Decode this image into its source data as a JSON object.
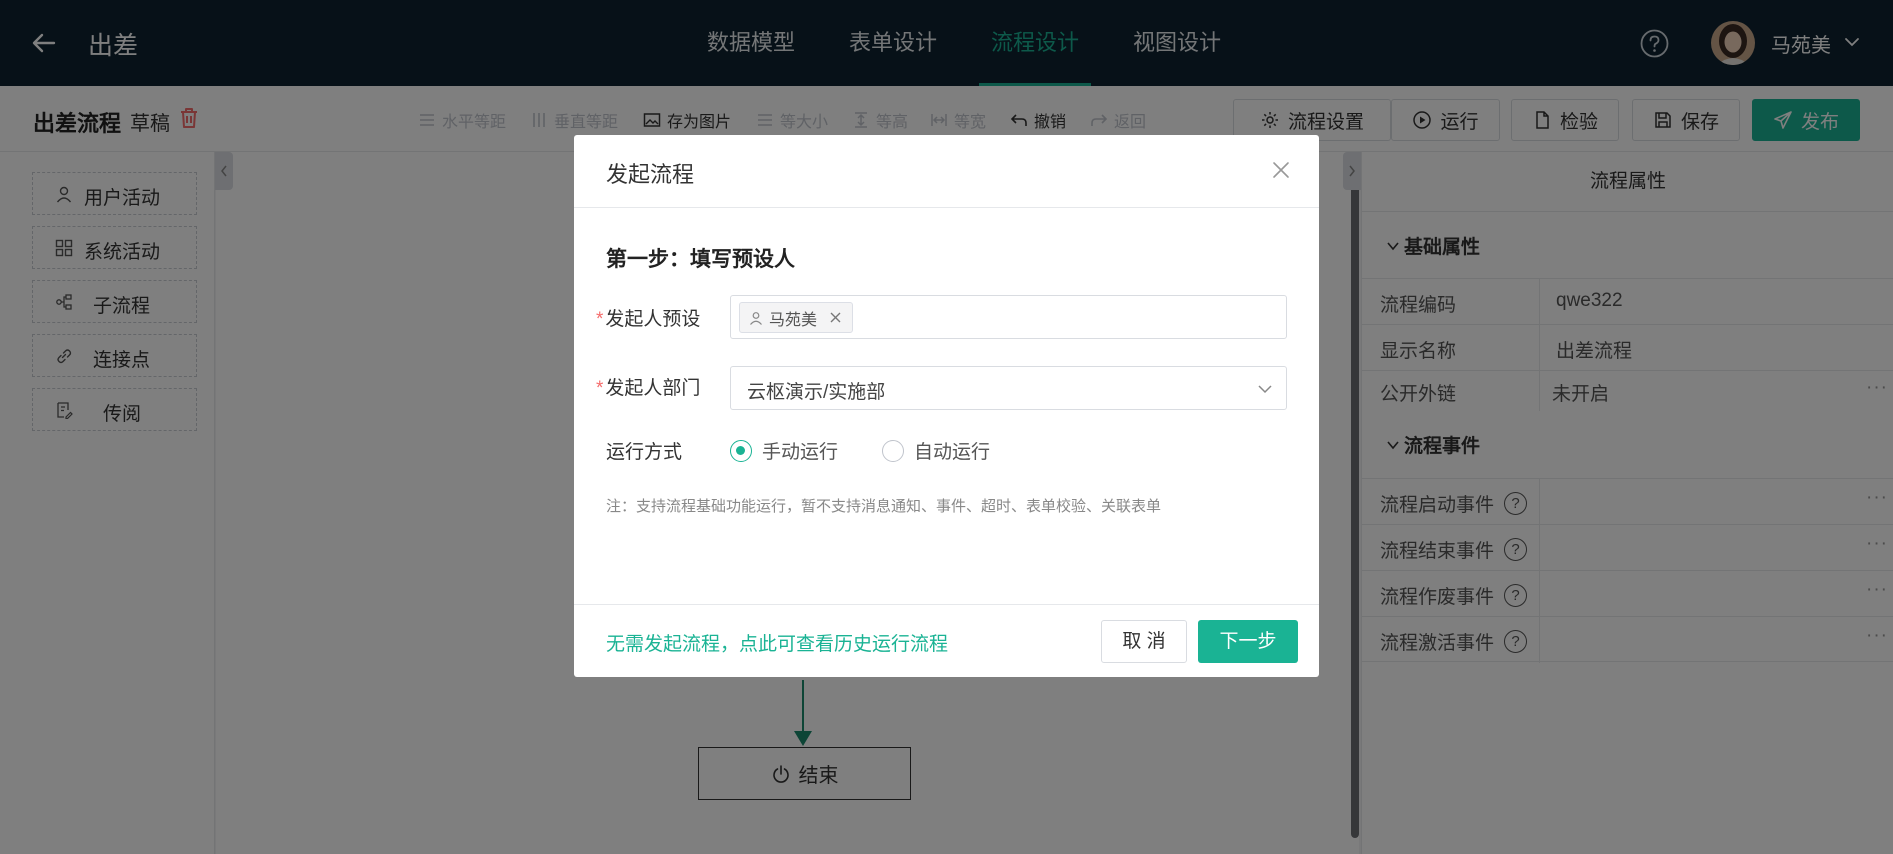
{
  "header": {
    "title": "出差",
    "tabs": [
      {
        "label": "数据模型",
        "active": false
      },
      {
        "label": "表单设计",
        "active": false
      },
      {
        "label": "流程设计",
        "active": true
      },
      {
        "label": "视图设计",
        "active": false
      }
    ],
    "user": {
      "name": "马苑美"
    }
  },
  "toolbar": {
    "flow_name": "出差流程",
    "status": "草稿",
    "tools": {
      "h_spacing": "水平等距",
      "v_spacing": "垂直等距",
      "save_image": "存为图片",
      "same_size": "等大小",
      "same_height": "等高",
      "same_width": "等宽",
      "undo": "撤销",
      "redo": "返回"
    },
    "buttons": {
      "settings": "流程设置",
      "run": "运行",
      "check": "检验",
      "save": "保存",
      "publish": "发布"
    }
  },
  "palette": {
    "items": [
      {
        "label": "用户活动",
        "icon": "user-icon"
      },
      {
        "label": "系统活动",
        "icon": "grid-icon"
      },
      {
        "label": "子流程",
        "icon": "subflow-icon"
      },
      {
        "label": "连接点",
        "icon": "link-icon"
      },
      {
        "label": "传阅",
        "icon": "circulate-icon"
      }
    ]
  },
  "canvas": {
    "end_node": "结束"
  },
  "properties": {
    "title": "流程属性",
    "basic_section": "基础属性",
    "basic_rows": [
      {
        "key": "流程编码",
        "value": "qwe322"
      },
      {
        "key": "显示名称",
        "value": "出差流程"
      },
      {
        "key": "公开外链",
        "value": "未开启",
        "more": "···"
      }
    ],
    "event_section": "流程事件",
    "event_rows": [
      {
        "key": "流程启动事件",
        "more": "···"
      },
      {
        "key": "流程结束事件",
        "more": "···"
      },
      {
        "key": "流程作废事件",
        "more": "···"
      },
      {
        "key": "流程激活事件",
        "more": "···"
      }
    ],
    "help_glyph": "?"
  },
  "modal": {
    "title": "发起流程",
    "step_title": "第一步：填写预设人",
    "initiator_label": "发起人预设",
    "initiator_tag": "马苑美",
    "dept_label": "发起人部门",
    "dept_value": "云枢演示/实施部",
    "run_mode_label": "运行方式",
    "run_options": [
      {
        "label": "手动运行",
        "checked": true
      },
      {
        "label": "自动运行",
        "checked": false
      }
    ],
    "required_mark": "*",
    "note": "注：支持流程基础功能运行，暂不支持消息通知、事件、超时、表单校验、关联表单",
    "history_link": "无需发起流程，点此可查看历史运行流程",
    "cancel": "取 消",
    "next": "下一步"
  },
  "colors": {
    "accent": "#1ab394",
    "topbar_bg": "#0e2330",
    "danger": "#f56c6c"
  }
}
